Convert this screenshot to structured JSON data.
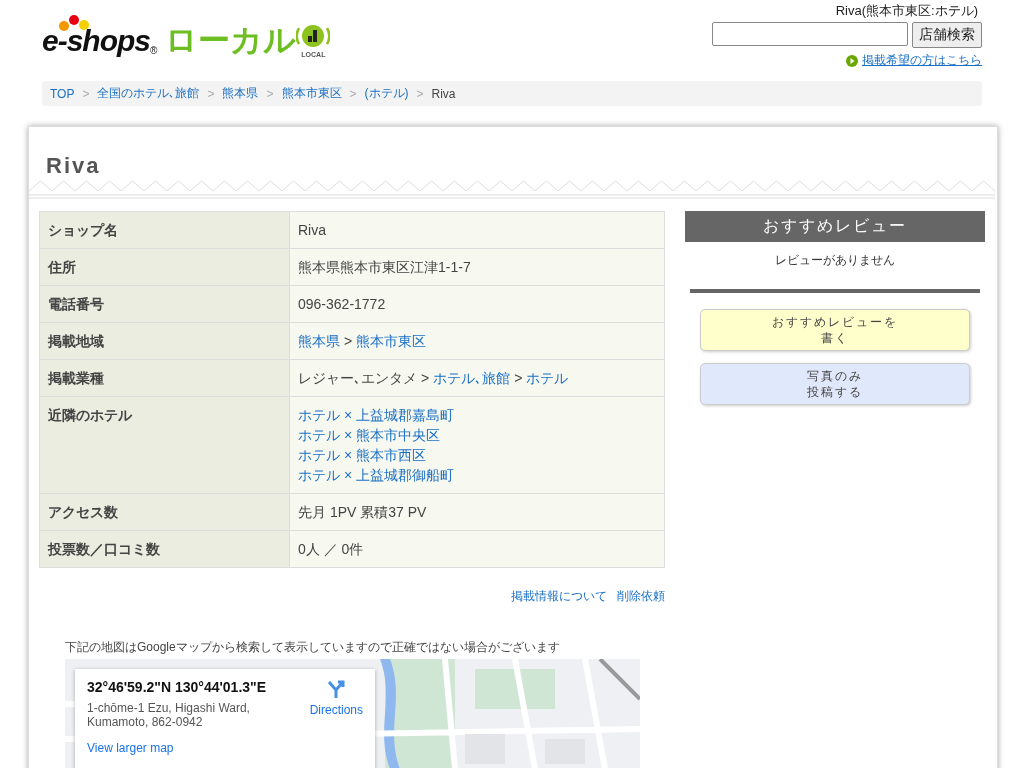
{
  "logo": {
    "brand": "e-shops",
    "registered": "®",
    "local_jp": "ローカル",
    "local_en": "LOCAL"
  },
  "header": {
    "page_caption": "Riva(熊本市東区:ホテル)",
    "search_button": "店舗検索",
    "listing_link": "掲載希望の方はこちら"
  },
  "breadcrumb": [
    {
      "text": "TOP",
      "link": true
    },
    {
      "separator": ">",
      "text": "全国のホテル､旅館",
      "link": true
    },
    {
      "separator": ">",
      "text": "熊本県",
      "link": true
    },
    {
      "separator": ">",
      "text": "熊本市東区",
      "link": true
    },
    {
      "separator": ">",
      "text": "(ホテル)",
      "link": true
    },
    {
      "separator": ">",
      "text": "Riva",
      "link": false
    }
  ],
  "title": "Riva",
  "table": {
    "rows": [
      {
        "label": "ショップ名",
        "lines": [
          [
            {
              "text": "Riva",
              "link": false
            }
          ]
        ]
      },
      {
        "label": "住所",
        "lines": [
          [
            {
              "text": "熊本県熊本市東区江津1-1-7",
              "link": false
            }
          ]
        ]
      },
      {
        "label": "電話番号",
        "lines": [
          [
            {
              "text": "096-362-1772",
              "link": false
            }
          ]
        ]
      },
      {
        "label": "掲載地域",
        "lines": [
          [
            {
              "text": "熊本県",
              "link": true
            },
            {
              "text": ">",
              "link": false
            },
            {
              "text": "熊本市東区",
              "link": true
            }
          ]
        ]
      },
      {
        "label": "掲載業種",
        "lines": [
          [
            {
              "text": "レジャー､エンタメ",
              "link": false
            },
            {
              "text": ">",
              "link": false
            },
            {
              "text": "ホテル､旅館",
              "link": true
            },
            {
              "text": ">",
              "link": false
            },
            {
              "text": "ホテル",
              "link": true
            }
          ]
        ]
      },
      {
        "label": "近隣のホテル",
        "lines": [
          [
            {
              "text": "ホテル × 上益城郡嘉島町",
              "link": true
            }
          ],
          [
            {
              "text": "ホテル × 熊本市中央区",
              "link": true
            }
          ],
          [
            {
              "text": "ホテル × 熊本市西区",
              "link": true
            }
          ],
          [
            {
              "text": "ホテル × 上益城郡御船町",
              "link": true
            }
          ]
        ]
      },
      {
        "label": "アクセス数",
        "lines": [
          [
            {
              "text": "先月 1PV 累積37 PV",
              "link": false
            }
          ]
        ]
      },
      {
        "label": "投票数／口コミ数",
        "lines": [
          [
            {
              "text": "0人 ／ 0件",
              "link": false
            }
          ]
        ]
      }
    ]
  },
  "footer_links": [
    "掲載情報について",
    "削除依頼"
  ],
  "map": {
    "note": "下記の地図はGoogleマップから検索して表示していますので正確ではない場合がございます",
    "card": {
      "coords": "32°46'59.2\"N 130°44'01.3\"E",
      "address": "1-chōme-1 Ezu, Higashi Ward, Kumamoto, 862-0942",
      "directions": "Directions",
      "larger_map": "View larger map"
    }
  },
  "sidebar": {
    "heading": "おすすめレビュー",
    "empty": "レビューがありません",
    "buttons": [
      {
        "lines": [
          "おすすめレビューを",
          "書く"
        ],
        "kind": "review"
      },
      {
        "lines": [
          "写真のみ",
          "投稿する"
        ]
      }
    ]
  }
}
